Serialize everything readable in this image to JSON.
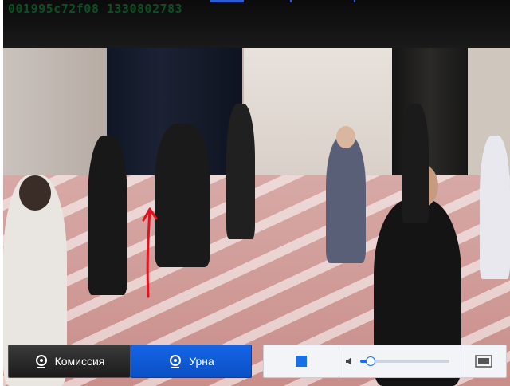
{
  "stream": {
    "camera_id": "001995c72f08 1330802783"
  },
  "controls": {
    "tabs": [
      {
        "label": "Комиссия",
        "icon": "webcam-icon",
        "active": false
      },
      {
        "label": "Урна",
        "icon": "webcam-icon",
        "active": true
      }
    ],
    "stop_icon": "stop-icon",
    "volume_icon": "speaker-icon",
    "volume_level": 0.06,
    "fullscreen_icon": "fullscreen-icon"
  },
  "colors": {
    "accent": "#1a6ee8",
    "dark_tab": "#2a2a2a"
  }
}
